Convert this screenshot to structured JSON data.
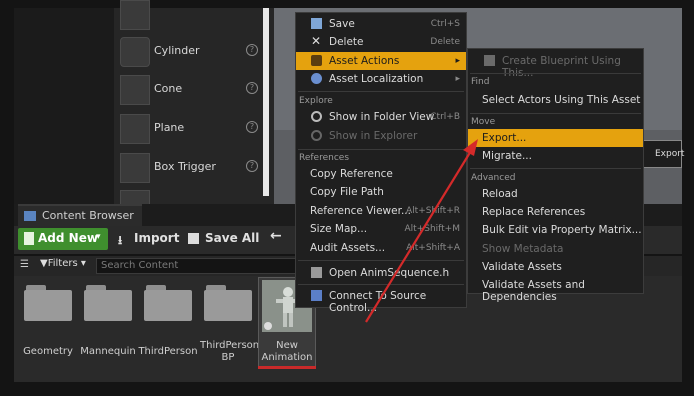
{
  "left_panel": {
    "items": [
      {
        "label": "Cylinder"
      },
      {
        "label": "Cone"
      },
      {
        "label": "Plane"
      },
      {
        "label": "Box Trigger"
      }
    ]
  },
  "viewport": {
    "button_text": "Export"
  },
  "content_browser": {
    "tab_label": "Content Browser",
    "toolbar": {
      "add_new": "Add New",
      "import": "Import",
      "save_all": "Save All"
    },
    "filters_label": "Filters",
    "search_placeholder": "Search Content",
    "assets": [
      {
        "label": "Geometry"
      },
      {
        "label": "Mannequin"
      },
      {
        "label": "ThirdPerson"
      },
      {
        "label": "ThirdPerson BP"
      },
      {
        "label": "New Animation"
      }
    ]
  },
  "context_menu": {
    "save": {
      "label": "Save",
      "shortcut": "Ctrl+S"
    },
    "delete": {
      "label": "Delete",
      "shortcut": "Delete"
    },
    "asset_actions": {
      "label": "Asset Actions"
    },
    "asset_localization": {
      "label": "Asset Localization"
    },
    "explore_header": "Explore",
    "show_in_folder": {
      "label": "Show in Folder View",
      "shortcut": "Ctrl+B"
    },
    "show_in_explorer": {
      "label": "Show in Explorer"
    },
    "references_header": "References",
    "copy_reference": {
      "label": "Copy Reference"
    },
    "copy_file_path": {
      "label": "Copy File Path"
    },
    "reference_viewer": {
      "label": "Reference Viewer...",
      "shortcut": "Alt+Shift+R"
    },
    "size_map": {
      "label": "Size Map...",
      "shortcut": "Alt+Shift+M"
    },
    "audit_assets": {
      "label": "Audit Assets...",
      "shortcut": "Alt+Shift+A"
    },
    "open_anim": {
      "label": "Open AnimSequence.h"
    },
    "connect_source": {
      "label": "Connect To Source Control..."
    }
  },
  "submenu": {
    "create_blueprint": "Create Blueprint Using This...",
    "find_header": "Find",
    "select_actors": "Select Actors Using This Asset",
    "move_header": "Move",
    "export": "Export...",
    "migrate": "Migrate...",
    "advanced_header": "Advanced",
    "reload": "Reload",
    "replace_refs": "Replace References",
    "bulk_edit": "Bulk Edit via Property Matrix...",
    "show_metadata": "Show Metadata",
    "validate_assets": "Validate Assets",
    "validate_deps": "Validate Assets and Dependencies"
  },
  "colors": {
    "highlight": "#e5a20e",
    "add_new_green": "#3f8f2e",
    "annotation_red": "#d42a2a"
  }
}
